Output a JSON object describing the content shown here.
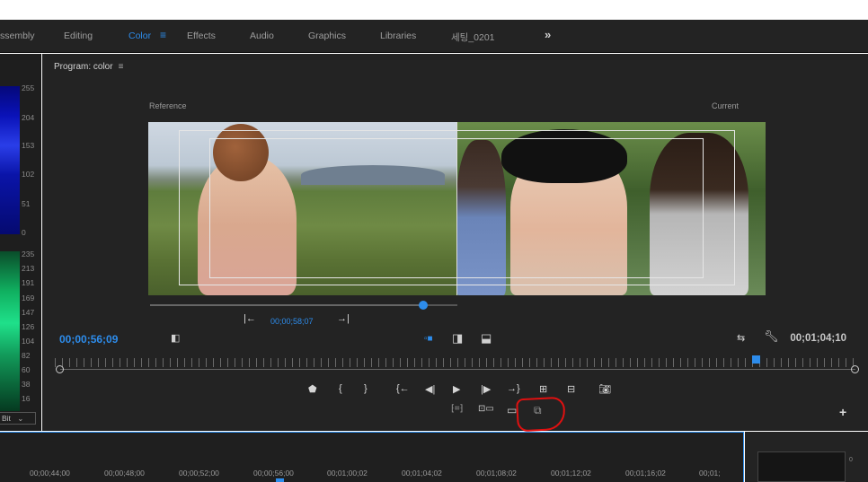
{
  "workspaces": {
    "tabs": [
      "ssembly",
      "Editing",
      "Color",
      "Effects",
      "Audio",
      "Graphics",
      "Libraries",
      "세팅_0201"
    ],
    "active": "Color",
    "menu_icon": "≡",
    "overflow": "»"
  },
  "scopes": {
    "luma_scale": [
      "255",
      "204",
      "153",
      "102",
      "51",
      "0"
    ],
    "wave_scale": [
      "235",
      "213",
      "191",
      "169",
      "147",
      "126",
      "104",
      "82",
      "60",
      "38",
      "16"
    ],
    "bit_depth": "Bit"
  },
  "program": {
    "title": "Program: color",
    "menu_icon": "≡",
    "reference_label": "Reference",
    "current_label": "Current",
    "reference_timecode": "00;00;58;07",
    "reference_position": 0.89,
    "timecode_in": "00;00;56;09",
    "timecode_duration": "00;01;04;10",
    "playhead_position": 0.87
  },
  "timeline": {
    "ticks": [
      "00;00;44;00",
      "00;00;48;00",
      "00;00;52;00",
      "00;00;56;00",
      "00;01;00;02",
      "00;01;04;02",
      "00;01;08;02",
      "00;01;12;02",
      "00;01;16;02",
      "00;01;"
    ]
  },
  "right_panel": {
    "scale_value": "0"
  }
}
